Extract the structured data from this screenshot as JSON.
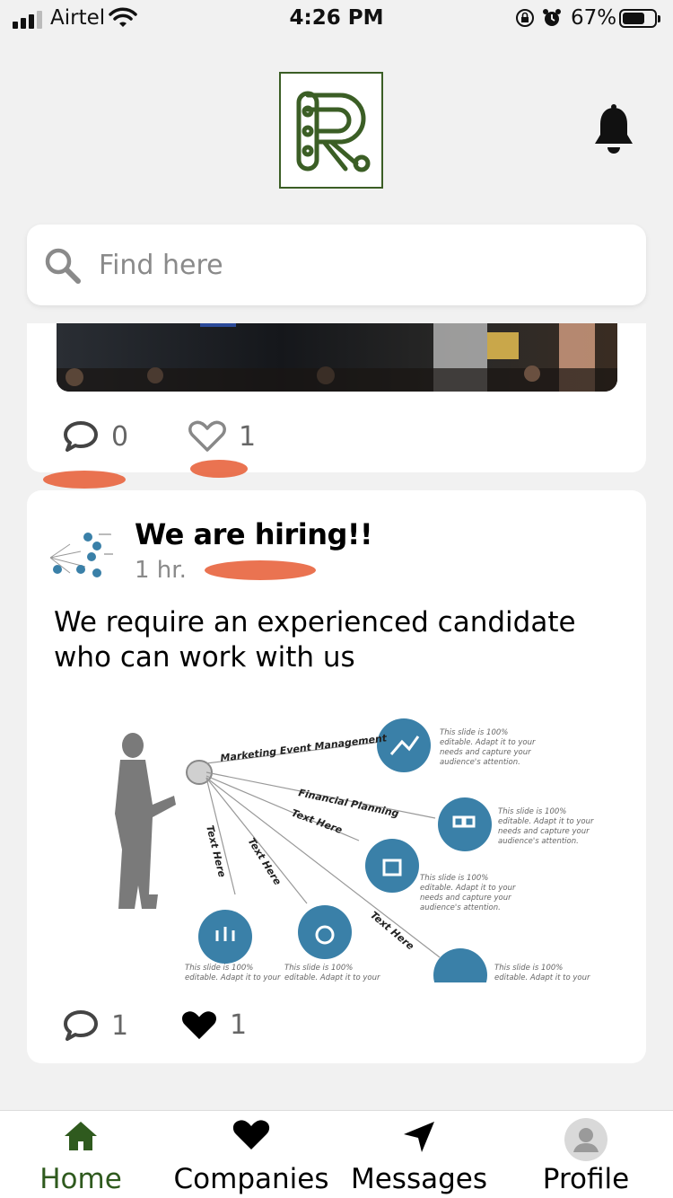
{
  "status_bar": {
    "carrier": "Airtel",
    "time": "4:26 PM",
    "battery": "67%"
  },
  "header": {
    "logo_icon": "R-logo",
    "notification_icon": "bell-icon"
  },
  "search": {
    "placeholder": "Find here"
  },
  "feed": {
    "previous_post": {
      "comment_count": "0",
      "like_count": "1"
    },
    "post": {
      "title": "We are hiring!!",
      "time": "1 hr.",
      "body": "We require an experienced candidate who can work with us",
      "comment_count": "1",
      "like_count": "1",
      "infographic": {
        "headings": [
          "Marketing Event Management",
          "Financial Planning",
          "Text Here",
          "Text Here",
          "Text Here",
          "Text Here"
        ],
        "caption": "This slide is 100% editable. Adapt it to your needs and capture your audience's attention."
      }
    }
  },
  "tab_bar": {
    "items": [
      {
        "label": "Home",
        "icon": "home-icon"
      },
      {
        "label": "Companies",
        "icon": "heart-icon"
      },
      {
        "label": "Messages",
        "icon": "navigation-arrow-icon"
      },
      {
        "label": "Profile",
        "icon": "avatar-icon"
      }
    ],
    "active": "Home"
  },
  "colors": {
    "brand_green": "#2f5a1e",
    "infographic_blue": "#3a80a8",
    "redaction": "#e8643e"
  }
}
